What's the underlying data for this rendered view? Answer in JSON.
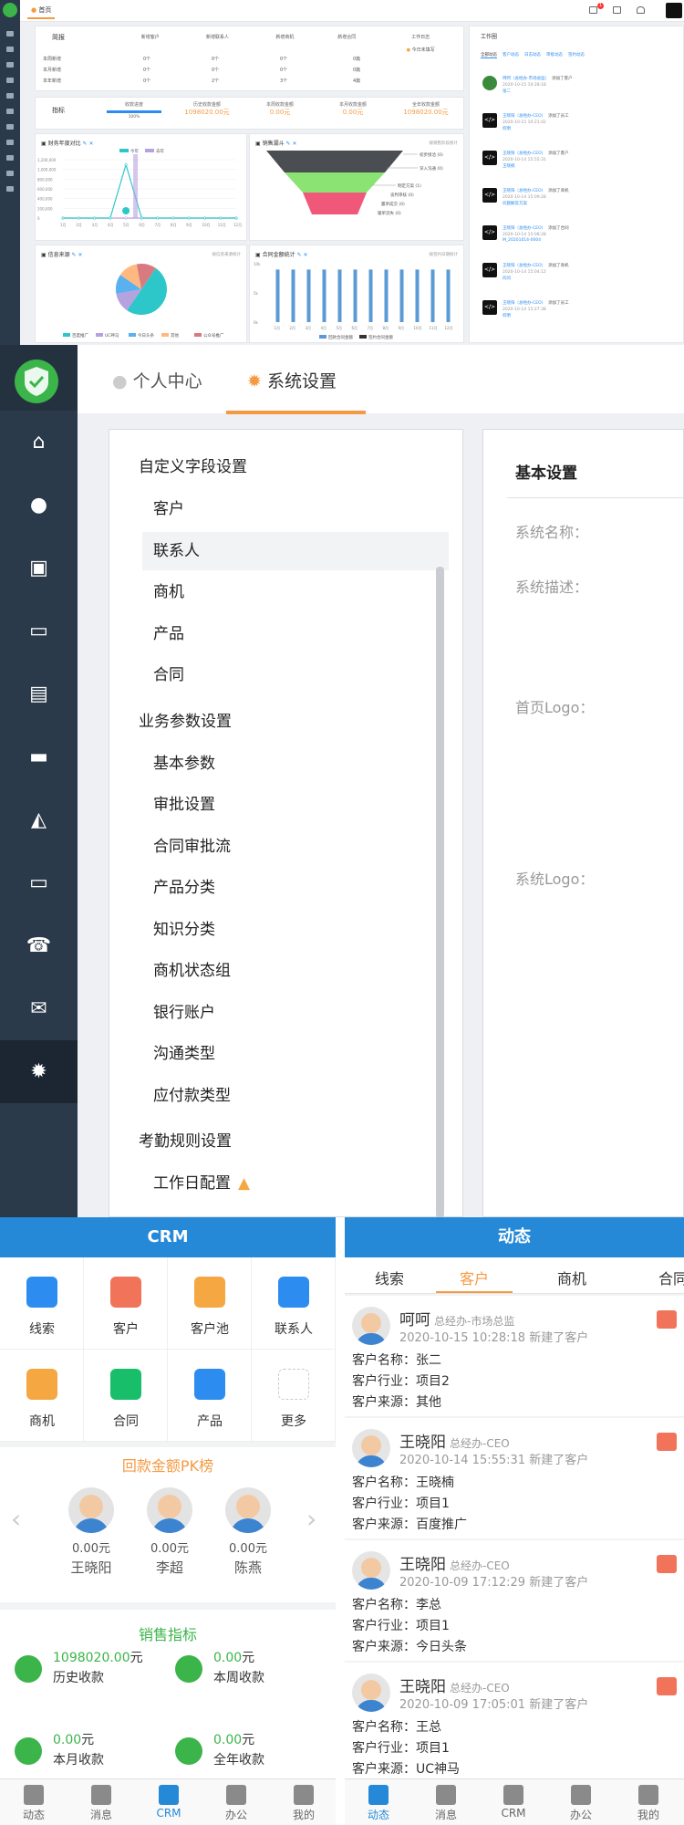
{
  "dashboard": {
    "home_tab": "首页",
    "badge_count": "1",
    "summary": {
      "title": "简报",
      "columns": [
        "新增客户",
        "新增联系人",
        "新增商机",
        "新增合同",
        "工作日志"
      ],
      "rows": [
        {
          "label": "本周新增",
          "cells": [
            "0个",
            "0个",
            "0个",
            "0篇"
          ]
        },
        {
          "label": "本月新增",
          "cells": [
            "0个",
            "0个",
            "0个",
            "0篇"
          ]
        },
        {
          "label": "本年新增",
          "cells": [
            "0个",
            "2个",
            "3个",
            "4篇"
          ]
        }
      ],
      "log_status": "今日未填写"
    },
    "kpi": {
      "title": "指标",
      "items": [
        {
          "label": "收款进度",
          "value": "100%"
        },
        {
          "label": "历史收款金额",
          "value": "1098020.00元"
        },
        {
          "label": "本周收款金额",
          "value": "0.00元"
        },
        {
          "label": "本月收款金额",
          "value": "0.00元"
        },
        {
          "label": "全年收款金额",
          "value": "1098020.00元"
        }
      ]
    },
    "chart_sales": {
      "title": "财务年度对比",
      "legend": [
        "今年",
        "去年"
      ]
    },
    "chart_funnel": {
      "title": "销售漏斗",
      "right": "按销售阶段统计",
      "labels": [
        "初步接洽 (0)",
        "深入沟通 (0)",
        "制定方案 (1)",
        "谈判审核 (0)",
        "赢单成交 (0)",
        "输单流失 (0)"
      ]
    },
    "chart_source": {
      "title": "信息来源",
      "right": "按信息来源统计",
      "legend": [
        "百度推广",
        "UC神马",
        "今日头条",
        "其他",
        "公众号推广"
      ]
    },
    "chart_contract": {
      "title": "合同金额统计",
      "right": "按签约日期统计",
      "legend": [
        "回款合同金额",
        "签约合同金额"
      ]
    },
    "activity": {
      "title": "工作圈",
      "tabs": [
        "全部动态",
        "客户动态",
        "日志动态",
        "审批动态",
        "签约动态"
      ],
      "items": [
        {
          "who": "呵呵（总经办-市场总监）",
          "act": "添加了客户",
          "time": "2020-10-15 10:28:18",
          "target": "张二",
          "kind": "photo"
        },
        {
          "who": "王晓阳（总经办-CEO）",
          "act": "添加了员工",
          "time": "2020-10-15 10:21:42",
          "target": "何明",
          "kind": "cat"
        },
        {
          "who": "王晓阳（总经办-CEO）",
          "act": "添加了客户",
          "time": "2020-10-14 15:55:31",
          "target": "王晓楠",
          "kind": "cat"
        },
        {
          "who": "王晓阳（总经办-CEO）",
          "act": "添加了商机",
          "time": "2020-10-14 15:09:28",
          "target": "问题解答方案",
          "kind": "cat"
        },
        {
          "who": "王晓阳（总经办-CEO）",
          "act": "添加了合同",
          "time": "2020-10-14 15:08:28",
          "target": "M_20201014-0004",
          "kind": "cat"
        },
        {
          "who": "王晓阳（总经办-CEO）",
          "act": "添加了商机",
          "time": "2020-10-14 15:04:12",
          "target": "问问",
          "kind": "cat"
        },
        {
          "who": "王晓阳（总经办-CEO）",
          "act": "添加了员工",
          "time": "2020-10-14 15:27:38",
          "target": "何明",
          "kind": "cat"
        }
      ]
    }
  },
  "chart_data": [
    {
      "type": "line",
      "title": "财务年度对比",
      "categories": [
        "1月",
        "2月",
        "3月",
        "4月",
        "5月",
        "6月",
        "7月",
        "8月",
        "9月",
        "10月",
        "11月",
        "12月"
      ],
      "y_ticks": [
        "1,200,000",
        "1,000,000",
        "800,000",
        "600,000",
        "400,000",
        "200,000",
        "0"
      ],
      "series": [
        {
          "name": "今年",
          "values": [
            0,
            0,
            0,
            0,
            1098020,
            0,
            0,
            0,
            0,
            0,
            0,
            0
          ]
        },
        {
          "name": "去年",
          "values": [
            0,
            0,
            0,
            0,
            0,
            0,
            0,
            0,
            0,
            0,
            0,
            0
          ]
        }
      ]
    },
    {
      "type": "pie",
      "title": "信息来源",
      "categories": [
        "百度推广",
        "UC神马",
        "今日头条",
        "其他",
        "公众号推广"
      ],
      "values": [
        50,
        12.5,
        12.5,
        12.5,
        12.5
      ]
    },
    {
      "type": "bar",
      "title": "合同金额统计",
      "categories": [
        "1月",
        "2月",
        "3月",
        "4月",
        "5月",
        "6月",
        "7月",
        "8月",
        "9月",
        "10月",
        "11月",
        "12月"
      ],
      "y_ticks": [
        "10k",
        "5k",
        "0k"
      ],
      "series": [
        {
          "name": "回款合同金额",
          "values": [
            9,
            9,
            9,
            9,
            9,
            9,
            9,
            9,
            9,
            9,
            9,
            9
          ]
        },
        {
          "name": "签约合同金额",
          "values": [
            0,
            0,
            0,
            0,
            0,
            0,
            0,
            0,
            0,
            0,
            0,
            0
          ]
        }
      ]
    }
  ],
  "settings": {
    "tabs": [
      "个人中心",
      "系统设置"
    ],
    "groups": [
      {
        "title": "自定义字段设置",
        "items": [
          "客户",
          "联系人",
          "商机",
          "产品",
          "合同"
        ]
      },
      {
        "title": "业务参数设置",
        "items": [
          "基本参数",
          "审批设置",
          "合同审批流",
          "产品分类",
          "知识分类",
          "商机状态组",
          "银行账户",
          "沟通类型",
          "应付款类型"
        ]
      },
      {
        "title": "考勤规则设置",
        "items": [
          "工作日配置"
        ]
      }
    ],
    "right_title": "基本设置",
    "right_fields": [
      "系统名称：",
      "系统描述：",
      "首页Logo：",
      "系统Logo："
    ]
  },
  "mobile_crm": {
    "title": "CRM",
    "grid": [
      {
        "label": "线索",
        "color": "#2d8cf0"
      },
      {
        "label": "客户",
        "color": "#f0735a"
      },
      {
        "label": "客户池",
        "color": "#f5a742"
      },
      {
        "label": "联系人",
        "color": "#2d8cf0"
      },
      {
        "label": "商机",
        "color": "#f5a742"
      },
      {
        "label": "合同",
        "color": "#19be6b"
      },
      {
        "label": "产品",
        "color": "#2d8cf0"
      },
      {
        "label": "更多",
        "color": "#ffffff"
      }
    ],
    "pk_title": "回款金额PK榜",
    "pk_people": [
      {
        "amount": "0.00元",
        "name": "王晓阳"
      },
      {
        "amount": "0.00元",
        "name": "李超"
      },
      {
        "amount": "0.00元",
        "name": "陈燕"
      }
    ],
    "metrics_title": "销售指标",
    "metrics": [
      {
        "value": "1098020.00",
        "unit": "元",
        "label": "历史收款"
      },
      {
        "value": "0.00",
        "unit": "元",
        "label": "本周收款"
      },
      {
        "value": "0.00",
        "unit": "元",
        "label": "本月收款"
      },
      {
        "value": "0.00",
        "unit": "元",
        "label": "全年收款"
      }
    ],
    "tabbar": [
      "动态",
      "消息",
      "CRM",
      "办公",
      "我的"
    ]
  },
  "mobile_feed": {
    "title": "动态",
    "tabs": [
      "线索",
      "客户",
      "商机",
      "合同"
    ],
    "cards": [
      {
        "name": "呵呵",
        "role": "总经办-市场总监",
        "meta": "2020-10-15 10:28:18 新建了客户",
        "lines": [
          "客户名称：张二",
          "客户行业：项目2",
          "客户来源：其他"
        ]
      },
      {
        "name": "王晓阳",
        "role": "总经办-CEO",
        "meta": "2020-10-14 15:55:31 新建了客户",
        "lines": [
          "客户名称：王晓楠",
          "客户行业：项目1",
          "客户来源：百度推广"
        ]
      },
      {
        "name": "王晓阳",
        "role": "总经办-CEO",
        "meta": "2020-10-09 17:12:29 新建了客户",
        "lines": [
          "客户名称：李总",
          "客户行业：项目1",
          "客户来源：今日头条"
        ]
      },
      {
        "name": "王晓阳",
        "role": "总经办-CEO",
        "meta": "2020-10-09 17:05:01 新建了客户",
        "lines": [
          "客户名称：王总",
          "客户行业：项目1",
          "客户来源：UC神马"
        ]
      }
    ],
    "tabbar": [
      "动态",
      "消息",
      "CRM",
      "办公",
      "我的"
    ]
  }
}
